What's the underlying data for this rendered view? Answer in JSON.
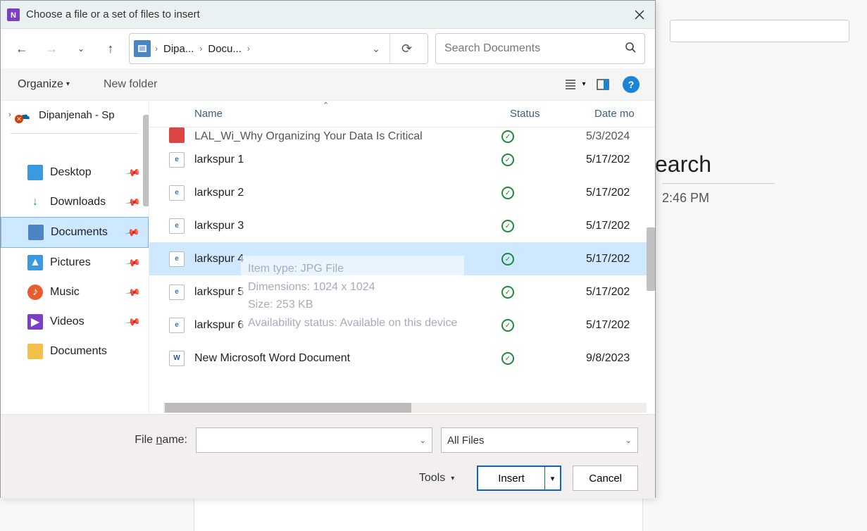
{
  "background": {
    "search_fragment": "earch",
    "timestamp": "2:46 PM"
  },
  "dialog": {
    "title": "Choose a file or a set of files to insert"
  },
  "breadcrumbs": {
    "crumb1": "Dipa...",
    "crumb2": "Docu..."
  },
  "search": {
    "placeholder": "Search Documents"
  },
  "toolbar": {
    "organize": "Organize",
    "new_folder": "New folder"
  },
  "sidebar": {
    "onedrive": "Dipanjenah - Sp",
    "items": [
      {
        "label": "Desktop"
      },
      {
        "label": "Downloads"
      },
      {
        "label": "Documents"
      },
      {
        "label": "Pictures"
      },
      {
        "label": "Music"
      },
      {
        "label": "Videos"
      },
      {
        "label": "Documents"
      }
    ]
  },
  "columns": {
    "name": "Name",
    "status": "Status",
    "date": "Date mo"
  },
  "files": [
    {
      "name": "LAL_Wi_Why Organizing Your Data Is Critical",
      "date": "5/3/2024"
    },
    {
      "name": "larkspur 1",
      "date": "5/17/202"
    },
    {
      "name": "larkspur 2",
      "date": "5/17/202"
    },
    {
      "name": "larkspur 3",
      "date": "5/17/202"
    },
    {
      "name": "larkspur 4",
      "date": "5/17/202"
    },
    {
      "name": "larkspur 5",
      "date": "5/17/202"
    },
    {
      "name": "larkspur 6",
      "date": "5/17/202"
    },
    {
      "name": "New Microsoft Word Document",
      "date": "9/8/2023"
    }
  ],
  "tooltip": {
    "l1": "Item type: JPG File",
    "l2": "Dimensions: 1024 x 1024",
    "l3": "Size: 253 KB",
    "l4": "Availability status: Available on this device"
  },
  "bottom": {
    "file_name_label": "File name:",
    "file_name_value": "",
    "filter": "All Files",
    "tools": "Tools",
    "insert": "Insert",
    "cancel": "Cancel"
  }
}
